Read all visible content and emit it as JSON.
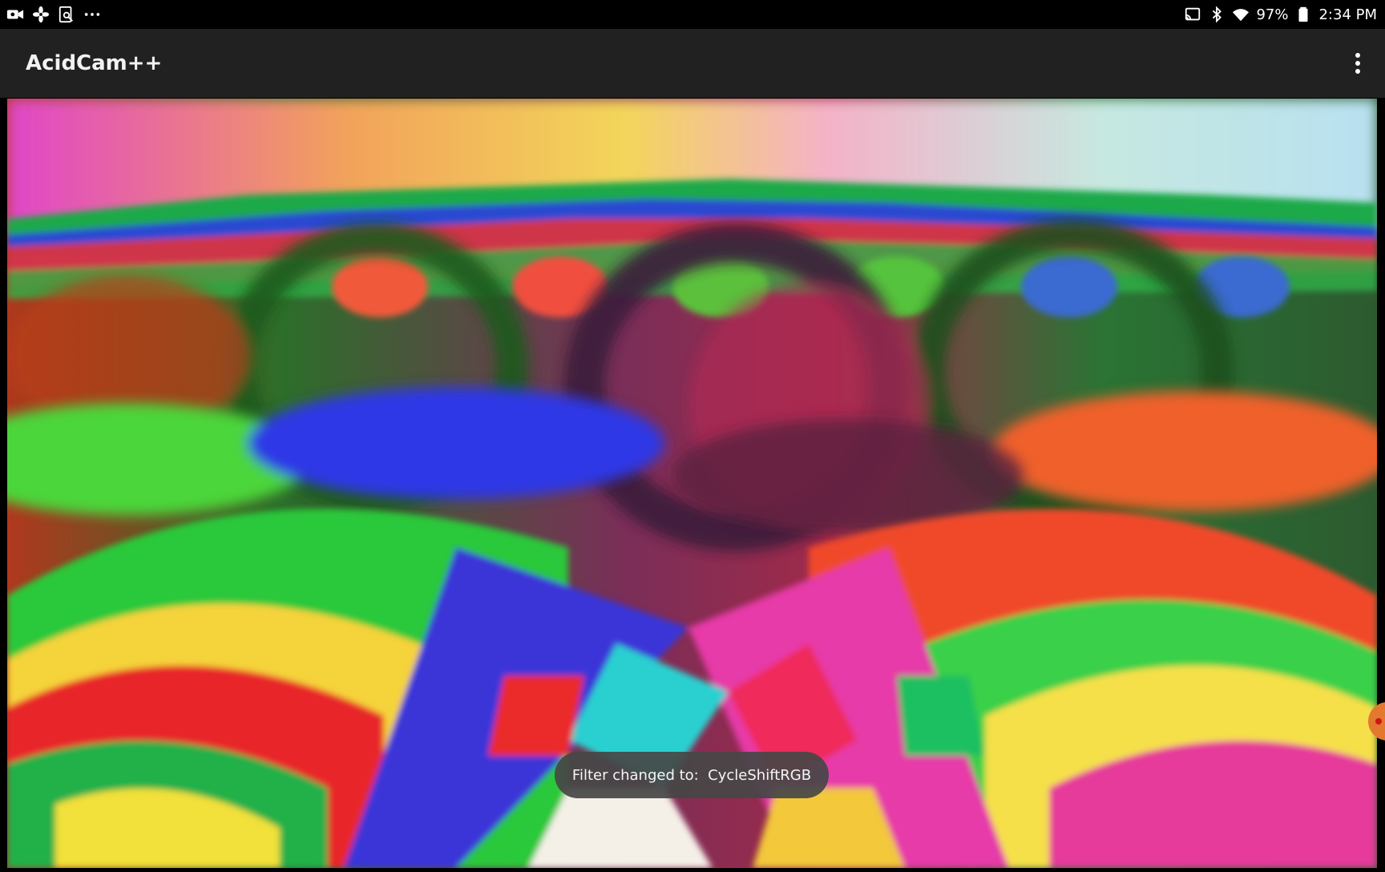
{
  "status_bar": {
    "left_icons": [
      "video-camera-icon",
      "fan-icon",
      "screenshot-search-icon",
      "more-dots-icon"
    ],
    "right_icons": [
      "cast-icon",
      "bluetooth-icon",
      "wifi-icon",
      "battery-icon"
    ],
    "battery": "97%",
    "time": "2:34 PM"
  },
  "app_bar": {
    "title": "AcidCam++",
    "menu_icon": "overflow-menu-icon"
  },
  "camera_view": {
    "description_icon": "filtered-camera-preview"
  },
  "toast": {
    "message": "Filter changed to:  CycleShiftRGB"
  },
  "colors": {
    "status_bar_bg": "#000000",
    "app_bar_bg": "#212121",
    "toast_bg": "#464646",
    "edge_handle": "#e2792e"
  }
}
